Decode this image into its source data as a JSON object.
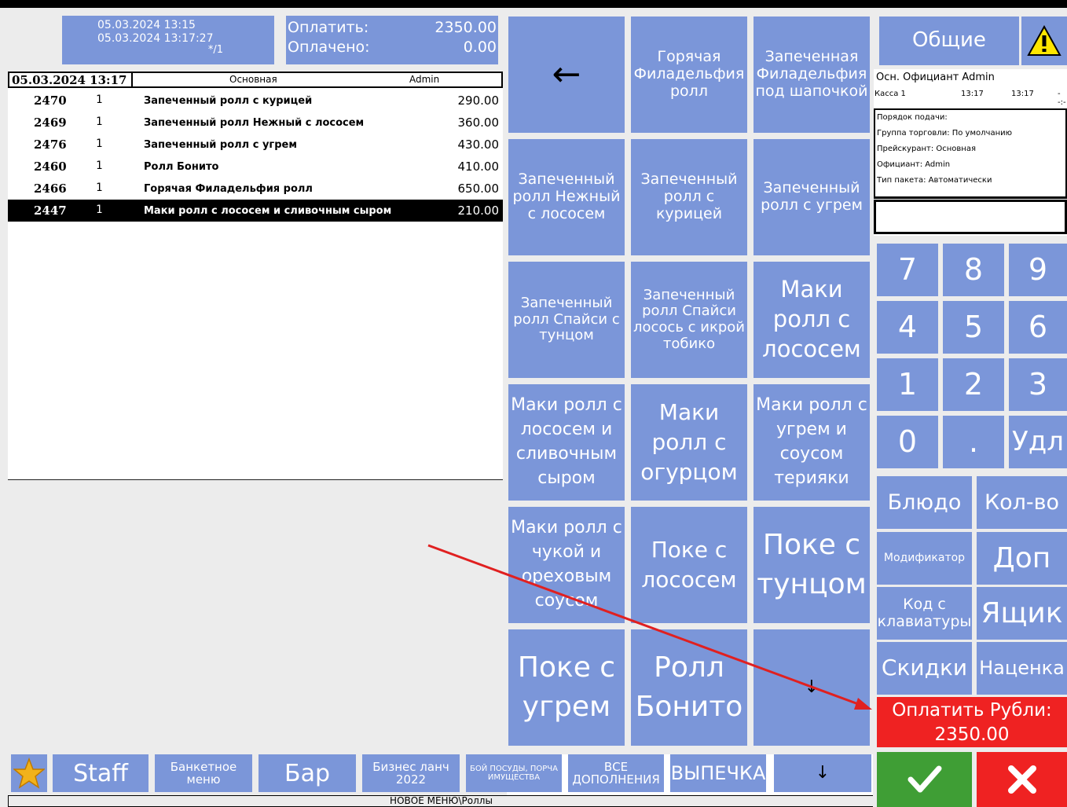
{
  "header": {
    "date_open": "05.03.2024 13:15",
    "date_now": "05.03.2024 13:17:27",
    "order_mark": "*/1",
    "to_pay_label": "Оплатить:",
    "to_pay_value": "2350.00",
    "paid_label": "Оплачено:",
    "paid_value": "0.00"
  },
  "order": {
    "datetime": "05.03.2024 13:17",
    "menu": "Основная",
    "user": "Admin",
    "rows": [
      {
        "code": "2470",
        "qty": "1",
        "name": "Запеченный ролл с курицей",
        "price": "290.00"
      },
      {
        "code": "2469",
        "qty": "1",
        "name": "Запеченный ролл Нежный с лососем",
        "price": "360.00"
      },
      {
        "code": "2476",
        "qty": "1",
        "name": "Запеченный ролл с угрем",
        "price": "430.00"
      },
      {
        "code": "2460",
        "qty": "1",
        "name": "Ролл Бонито",
        "price": "410.00"
      },
      {
        "code": "2466",
        "qty": "1",
        "name": "Горячая Филадельфия ролл",
        "price": "650.00"
      },
      {
        "code": "2447",
        "qty": "1",
        "name": "Маки ролл с лососем и сливочным сыром",
        "price": "210.00"
      }
    ]
  },
  "grid": {
    "back_arrow": "←",
    "items": [
      "Горячая Филадельфия ролл",
      "Запеченная Филадельфия под шапочкой",
      "Запеченный ролл Нежный с лососем",
      "Запеченный ролл с курицей",
      "Запеченный ролл с угрем",
      "Запеченный ролл Спайси с тунцом",
      "Запеченный ролл Спайси лосось с икрой тобико",
      "Маки ролл с лососем",
      "Маки ролл с лососем и сливочным сыром",
      "Маки ролл с огурцом",
      "Маки ролл с угрем и соусом терияки",
      "Маки ролл с чукой и ореховым соусом",
      "Поке с лососем",
      "Поке с тунцом",
      "Поке с угрем",
      "Ролл Бонито"
    ],
    "down_arrow": "↓"
  },
  "categories": {
    "star_icon": "star-icon",
    "items": [
      "Staff",
      "Банкетное меню",
      "Бар",
      "Бизнес ланч 2022",
      "БОЙ ПОСУДЫ, ПОРЧА ИМУЩЕСТВА",
      "ВСЕ ДОПОЛНЕНИЯ",
      "ВЫПЕЧКА"
    ],
    "scroll_arrow": "↓"
  },
  "status_path": "НОВОЕ МЕНЮ\\Роллы",
  "right": {
    "group_label": "Общие",
    "warning_icon": "warning-icon",
    "waiter_line": "Осн. Официант  Admin",
    "register": "Касса 1",
    "time1": "13:17",
    "time2": "13:17",
    "time3": "--:-",
    "details": [
      "Порядок подачи:",
      "Группа торговли: По умолчанию",
      "Прейскурант: Основная",
      "Официант: Admin",
      "Тип пакета: Автоматически"
    ],
    "keypad": [
      "7",
      "8",
      "9",
      "4",
      "5",
      "6",
      "1",
      "2",
      "3",
      "0",
      ".",
      "Удл"
    ],
    "actions": {
      "dish": "Блюдо",
      "qty": "Кол-во",
      "modifier": "Модификатор",
      "extra": "Доп",
      "code_keyboard": "Код с клавиатуры",
      "drawer": "Ящик",
      "discounts": "Скидки",
      "markup": "Наценка"
    },
    "pay_label": "Оплатить Рубли:",
    "pay_value": "2350.00",
    "ok_icon": "checkmark-icon",
    "cancel_icon": "close-icon"
  },
  "colors": {
    "tile": "#7b96d9",
    "pay": "#ef2222",
    "ok": "#3f9e35",
    "annotation_arrow": "#e02020"
  }
}
